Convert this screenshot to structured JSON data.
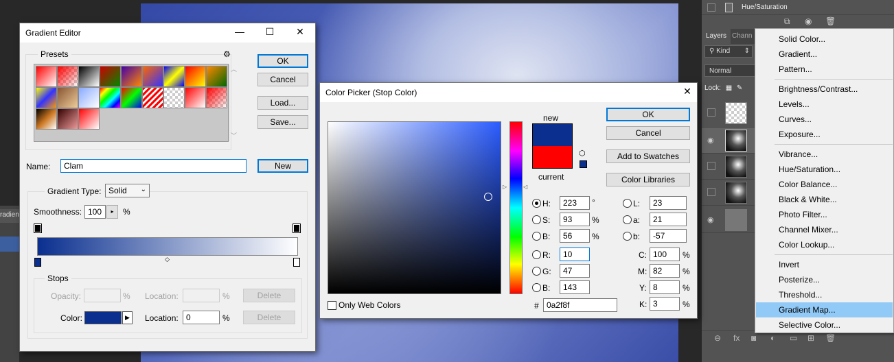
{
  "layers_panel": {
    "top_layer_label": "Hue/Saturation",
    "tab_layers": "Layers",
    "tab_channels": "Chann",
    "filter_kind": "Kind",
    "blend_mode": "Normal",
    "lock_label": "Lock:",
    "left_strip_tab": "radien"
  },
  "adjustment_menu": {
    "groups": [
      [
        "Solid Color...",
        "Gradient...",
        "Pattern..."
      ],
      [
        "Brightness/Contrast...",
        "Levels...",
        "Curves...",
        "Exposure..."
      ],
      [
        "Vibrance...",
        "Hue/Saturation...",
        "Color Balance...",
        "Black & White...",
        "Photo Filter...",
        "Channel Mixer...",
        "Color Lookup..."
      ],
      [
        "Invert",
        "Posterize...",
        "Threshold...",
        "Gradient Map...",
        "Selective Color..."
      ]
    ],
    "highlighted": "Gradient Map..."
  },
  "gradient_editor": {
    "title": "Gradient Editor",
    "presets_label": "Presets",
    "ok_label": "OK",
    "cancel_label": "Cancel",
    "load_label": "Load...",
    "save_label": "Save...",
    "name_label": "Name:",
    "name_value": "Clam",
    "new_label": "New",
    "gradient_type_label": "Gradient Type:",
    "gradient_type_value": "Solid",
    "smoothness_label": "Smoothness:",
    "smoothness_value": "100",
    "percent": "%",
    "stops_label": "Stops",
    "opacity_label": "Opacity:",
    "location_label": "Location:",
    "delete_label": "Delete",
    "color_label": "Color:",
    "color_location_value": "0",
    "stop_color": "#0a2f8f",
    "gradient_start": "#0a2f8f",
    "gradient_end": "#ffffff"
  },
  "color_picker": {
    "title": "Color Picker (Stop Color)",
    "new_label": "new",
    "current_label": "current",
    "new_color": "#0a2f8f",
    "current_color": "#ff0000",
    "ok_label": "OK",
    "cancel_label": "Cancel",
    "add_swatches_label": "Add to Swatches",
    "color_libraries_label": "Color Libraries",
    "only_web_label": "Only Web Colors",
    "hash": "#",
    "hex_value": "0a2f8f",
    "hsb": [
      {
        "label": "H:",
        "value": "223",
        "unit": "°"
      },
      {
        "label": "S:",
        "value": "93",
        "unit": "%"
      },
      {
        "label": "B:",
        "value": "56",
        "unit": "%"
      }
    ],
    "rgb": [
      {
        "label": "R:",
        "value": "10"
      },
      {
        "label": "G:",
        "value": "47"
      },
      {
        "label": "B:",
        "value": "143"
      }
    ],
    "lab": [
      {
        "label": "L:",
        "value": "23"
      },
      {
        "label": "a:",
        "value": "21"
      },
      {
        "label": "b:",
        "value": "-57"
      }
    ],
    "cmyk": [
      {
        "label": "C:",
        "value": "100",
        "unit": "%"
      },
      {
        "label": "M:",
        "value": "82",
        "unit": "%"
      },
      {
        "label": "Y:",
        "value": "8",
        "unit": "%"
      },
      {
        "label": "K:",
        "value": "3",
        "unit": "%"
      }
    ],
    "field_hue_color": "#2b5cff"
  }
}
